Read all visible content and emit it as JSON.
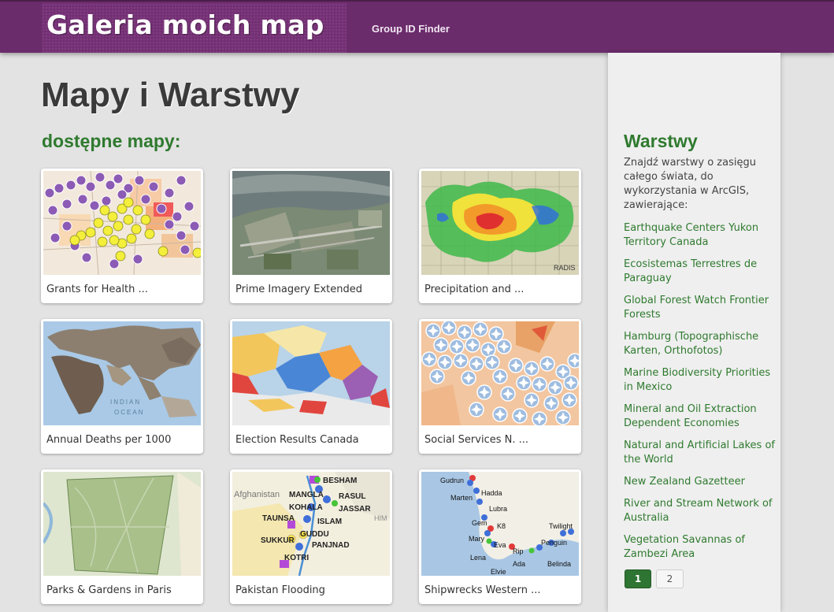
{
  "header": {
    "brand_title": "Galeria moich map",
    "nav_link": "Group ID Finder",
    "colors": {
      "header_bg": "#6b2c6b",
      "accent_green": "#2f7a2f"
    }
  },
  "main": {
    "page_title": "Mapy i Warstwy",
    "section_title": "dostępne mapy:",
    "cards": [
      {
        "label": "Grants for Health ...",
        "thumb": "purple-yellow-dot-map"
      },
      {
        "label": "Prime Imagery Extended",
        "thumb": "aerial-imagery"
      },
      {
        "label": "Precipitation and ...",
        "thumb": "radar-precipitation"
      },
      {
        "label": "Annual Deaths per 1000",
        "thumb": "world-map-shaded"
      },
      {
        "label": "Election Results Canada",
        "thumb": "canada-election-map"
      },
      {
        "label": "Social Services N. ...",
        "thumb": "blue-marker-cluster-map"
      },
      {
        "label": "Parks & Gardens in Paris",
        "thumb": "paris-park-map"
      },
      {
        "label": "Pakistan Flooding",
        "thumb": "pakistan-flood-map"
      },
      {
        "label": "Shipwrecks Western ...",
        "thumb": "shipwreck-coast-map"
      }
    ],
    "map_text": {
      "pakistan": [
        "BESHAM",
        "Afghanistan",
        "MANGLA",
        "RASUL",
        "KOHALA",
        "JASSAR",
        "TAUNSA",
        "ISLAM",
        "GUDDU",
        "SUKKUR",
        "PANJNAD",
        "KOTRI",
        "HIM"
      ],
      "shipwrecks": [
        "Gudrun",
        "Hadda",
        "Marten",
        "Lubra",
        "Gem",
        "K8",
        "Twilight",
        "Mary",
        "Penguin",
        "Eva",
        "Rip",
        "Lena",
        "Ada",
        "Belinda",
        "Elvie"
      ],
      "world": [
        "INDIAN",
        "OCEAN"
      ],
      "precip": [
        "RADIS"
      ]
    }
  },
  "sidebar": {
    "title": "Warstwy",
    "intro": "Znajdź warstwy o zasięgu całego świata, do wykorzystania w ArcGIS, zawierające:",
    "links": [
      "Earthquake Centers Yukon Territory Canada",
      "Ecosistemas Terrestres de Paraguay",
      "Global Forest Watch Frontier Forests",
      "Hamburg (Topographische Karten, Orthofotos)",
      "Marine Biodiversity Priorities in Mexico",
      "Mineral and Oil Extraction Dependent Economies",
      "Natural and Artificial Lakes of the World",
      "New Zealand Gazetteer",
      "River and Stream Network of Australia",
      "Vegetation Savannas of Zambezi Area"
    ],
    "pagination": {
      "active": "1",
      "next": "2"
    }
  }
}
